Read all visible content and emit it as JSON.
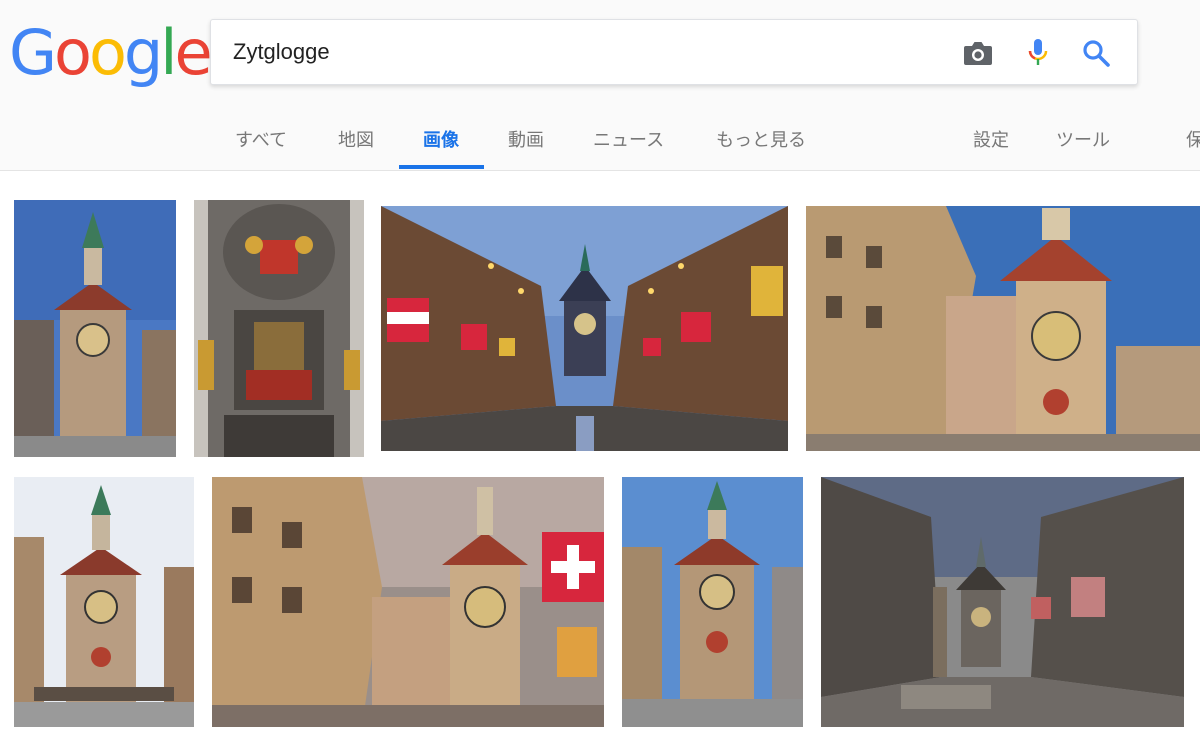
{
  "logo": {
    "text": "Google",
    "colors": [
      "#4285f4",
      "#ea4335",
      "#fbbc05",
      "#4285f4",
      "#34a853",
      "#ea4335"
    ]
  },
  "search": {
    "query": "Zytglogge"
  },
  "tabs": [
    {
      "label": "すべて"
    },
    {
      "label": "地図"
    },
    {
      "label": "画像"
    },
    {
      "label": "動画"
    },
    {
      "label": "ニュース"
    },
    {
      "label": "もっと見る"
    },
    {
      "label": "設定"
    },
    {
      "label": "ツール"
    },
    {
      "label": "保"
    }
  ],
  "active_tab": "画像",
  "accent_color": "#1a73e8",
  "icons": {
    "camera": "camera-icon",
    "mic": "microphone-icon",
    "search": "magnifier-search-icon"
  },
  "results": [
    {
      "subject": "Zytglogge clock tower, blue sky"
    },
    {
      "subject": "Zytglogge mechanical figures"
    },
    {
      "subject": "Kramgasse at dusk with flags"
    },
    {
      "subject": "Zytglogge clock tower from street"
    },
    {
      "subject": "Zytglogge tower with crowd"
    },
    {
      "subject": "Zytglogge with Swiss flag"
    },
    {
      "subject": "Zytglogge front view"
    },
    {
      "subject": "Kramgasse black and white with fountain"
    }
  ]
}
